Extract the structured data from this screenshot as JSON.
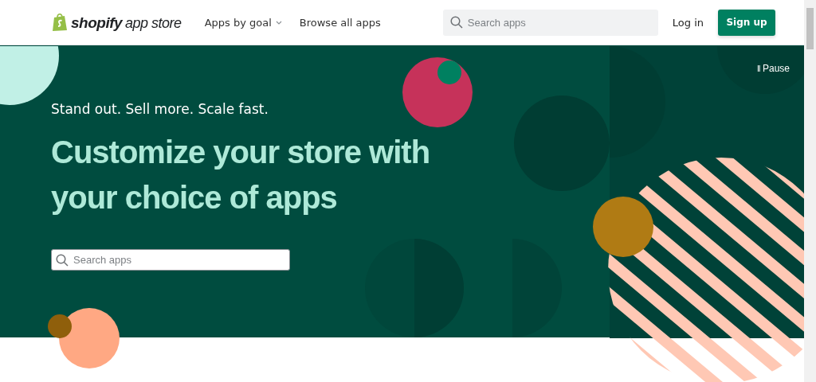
{
  "header": {
    "logo": {
      "brand": "shopify",
      "product": "app store"
    },
    "nav": [
      {
        "label": "Apps by goal",
        "kind": "dropdown"
      },
      {
        "label": "Browse all apps",
        "kind": "link"
      }
    ],
    "search": {
      "placeholder": "Search apps"
    },
    "login": "Log in",
    "signup": "Sign up"
  },
  "hero": {
    "pause": {
      "icon": "II",
      "label": "Pause"
    },
    "tagline": "Stand out. Sell more. Scale fast.",
    "headline": "Customize your store with your choice of apps",
    "search": {
      "placeholder": "Search apps"
    }
  }
}
